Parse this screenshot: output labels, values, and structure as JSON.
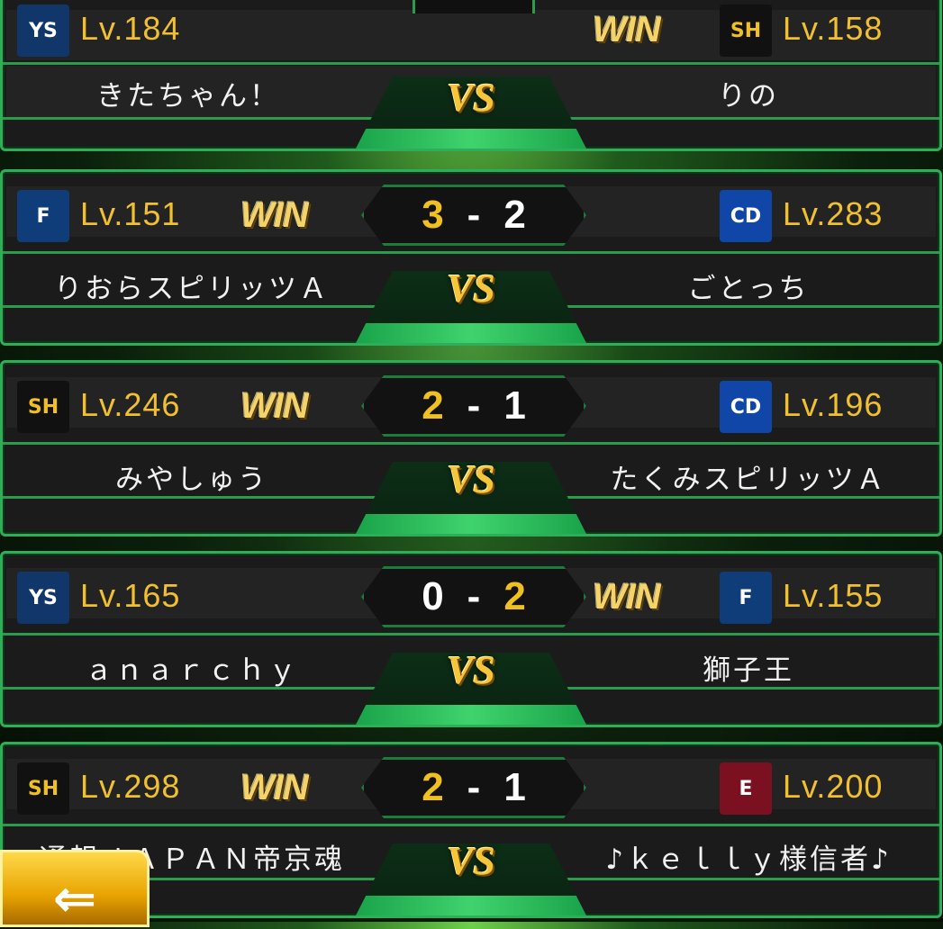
{
  "matches": [
    {
      "left": {
        "logo": "YS",
        "team": "swallows",
        "level": "Lv.184",
        "name": "きたちゃん！"
      },
      "right": {
        "logo": "SH",
        "team": "hawks",
        "level": "Lv.158",
        "name": "りの"
      },
      "winner": "right",
      "score": null,
      "vs": "VS"
    },
    {
      "left": {
        "logo": "F",
        "team": "fighters",
        "level": "Lv.151",
        "name": "りおらスピリッツＡ"
      },
      "right": {
        "logo": "CD",
        "team": "dragons",
        "level": "Lv.283",
        "name": "ごとっち"
      },
      "winner": "left",
      "score": {
        "left": "3",
        "dash": "-",
        "right": "2"
      },
      "vs": "VS"
    },
    {
      "left": {
        "logo": "SH",
        "team": "hawks",
        "level": "Lv.246",
        "name": "みやしゅう"
      },
      "right": {
        "logo": "CD",
        "team": "dragons",
        "level": "Lv.196",
        "name": "たくみスピリッツＡ"
      },
      "winner": "left",
      "score": {
        "left": "2",
        "dash": "-",
        "right": "1"
      },
      "vs": "VS"
    },
    {
      "left": {
        "logo": "YS",
        "team": "swallows",
        "level": "Lv.165",
        "name": "ａｎａｒｃｈｙ"
      },
      "right": {
        "logo": "F",
        "team": "fighters",
        "level": "Lv.155",
        "name": "獅子王"
      },
      "winner": "right",
      "score": {
        "left": "0",
        "dash": "-",
        "right": "2"
      },
      "vs": "VS"
    },
    {
      "left": {
        "logo": "SH",
        "team": "hawks",
        "level": "Lv.298",
        "name": "通報ＪＡＰＡＮ帝京魂"
      },
      "right": {
        "logo": "E",
        "team": "eagles",
        "level": "Lv.200",
        "name": "♪ｋｅｌｌｙ様信者♪"
      },
      "winner": "left",
      "score": {
        "left": "2",
        "dash": "-",
        "right": "1"
      },
      "vs": "VS"
    }
  ],
  "win_label": "WIN",
  "back_button": {
    "icon": "back-arrow-icon"
  },
  "colors": {
    "accent_green": "#2fae5a",
    "gold": "#f0c030",
    "win_gold": "#f4d36a"
  }
}
